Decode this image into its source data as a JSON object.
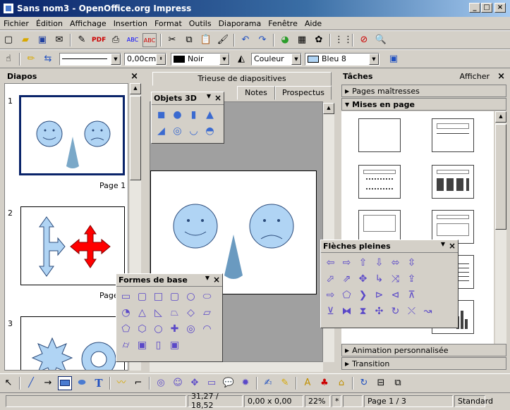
{
  "window": {
    "title": "Sans nom3 - OpenOffice.org Impress"
  },
  "menu": [
    "Fichier",
    "Édition",
    "Affichage",
    "Insertion",
    "Format",
    "Outils",
    "Diaporama",
    "Fenêtre",
    "Aide"
  ],
  "format_bar": {
    "line_width": "0,00cm",
    "line_color": "Noir",
    "area_style": "Couleur",
    "area_color": "Bleu 8"
  },
  "slides_panel": {
    "title": "Diapos",
    "slides": [
      {
        "num": "1",
        "label": "Page 1"
      },
      {
        "num": "2",
        "label": "Page"
      },
      {
        "num": "3"
      }
    ]
  },
  "tabs": {
    "sorter": "Trieuse de diapositives",
    "notes": "Notes",
    "handout": "Prospectus"
  },
  "palettes": {
    "objets3d": "Objets 3D",
    "formes": "Formes de base",
    "fleches": "Flèches pleines"
  },
  "tasks": {
    "title": "Tâches",
    "view": "Afficher",
    "sections": {
      "master": "Pages maîtresses",
      "layouts": "Mises en page",
      "animation": "Animation personnalisée",
      "transition": "Transition"
    }
  },
  "status": {
    "position": "31,27 / 18,52",
    "size": "0,00 x 0,00",
    "zoom": "22%",
    "modified": "*",
    "page": "Page 1 / 3",
    "layout": "Standard"
  },
  "colors": {
    "shape_fill": "#b0d4f4",
    "accent_red": "#ff0000",
    "palette_icon": "#7b68ee"
  }
}
